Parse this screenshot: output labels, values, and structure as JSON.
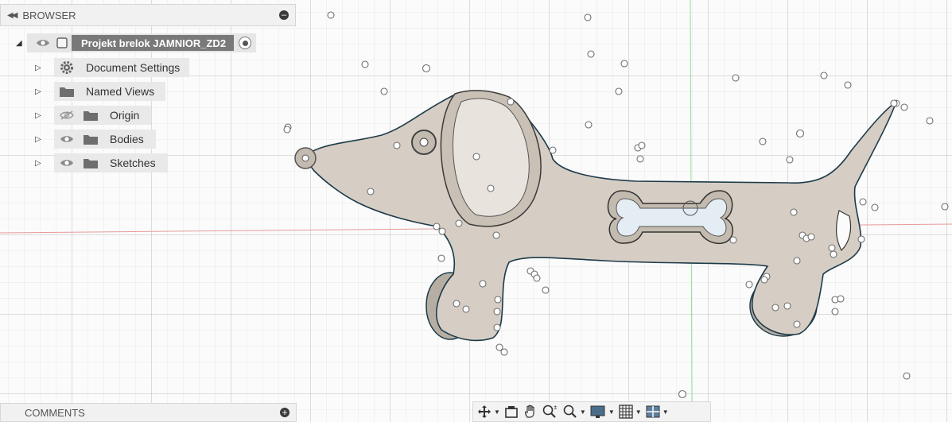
{
  "browser": {
    "title": "BROWSER",
    "root": {
      "label": "Projekt brelok JAMNIOR_ZD2"
    },
    "items": [
      {
        "label": "Document Settings",
        "icon": "gear-icon"
      },
      {
        "label": "Named Views",
        "icon": "folder-icon"
      },
      {
        "label": "Origin",
        "icon": "folder-icon",
        "visibility": "hidden"
      },
      {
        "label": "Bodies",
        "icon": "folder-icon",
        "visibility": "visible"
      },
      {
        "label": "Sketches",
        "icon": "folder-icon",
        "visibility": "visible"
      }
    ]
  },
  "comments": {
    "title": "COMMENTS"
  },
  "navbar": {
    "tools": [
      "orbit-icon",
      "look-at-icon",
      "pan-icon",
      "zoom-icon",
      "fit-icon",
      "display-settings-icon",
      "grid-icon",
      "viewports-icon"
    ]
  },
  "colors": {
    "body_fill": "#d6cec4",
    "outline": "#1d3a4a",
    "header_bg": "#f1f1f1"
  }
}
